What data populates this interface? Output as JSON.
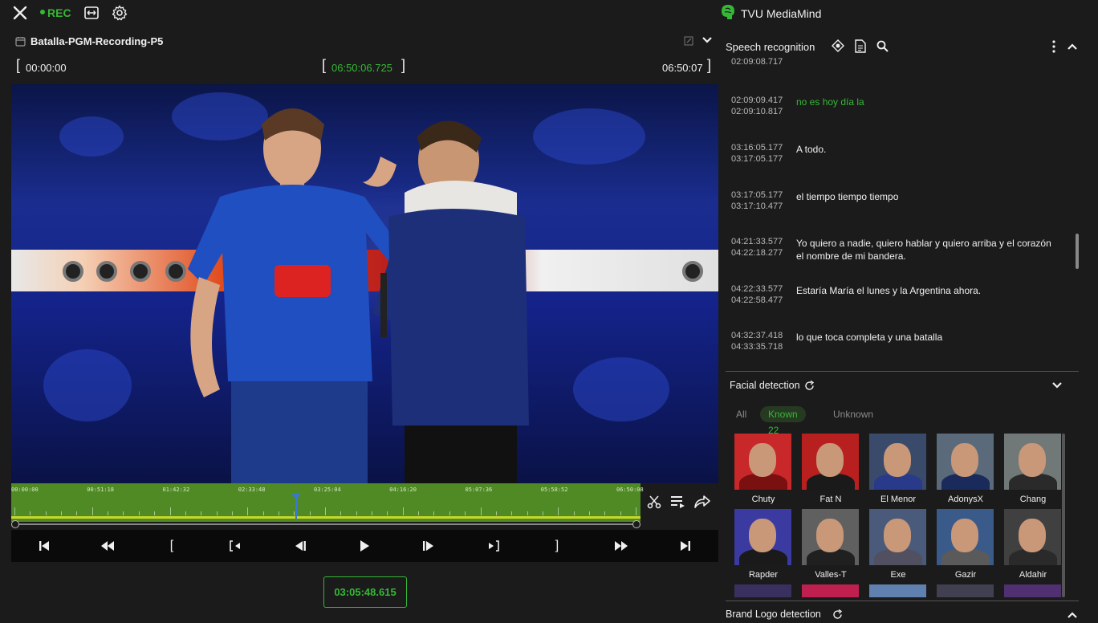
{
  "toolbar": {
    "close_icon": "close-icon",
    "rec_label": "REC",
    "fit_icon": "fit-width-icon",
    "settings_icon": "gear-icon"
  },
  "file": {
    "name": "Batalla-PGM-Recording-P5",
    "icon": "calendar-icon"
  },
  "times": {
    "start": "00:00:00",
    "in_point": "06:50:06.725",
    "end": "06:50:07",
    "current": "03:05:48.615"
  },
  "timeline": {
    "ticks": [
      "00:00:00",
      "00:51:18",
      "01:42:32",
      "02:33:48",
      "03:25:04",
      "04:16:20",
      "05:07:36",
      "05:58:52",
      "06:50:08"
    ],
    "playhead_fraction": 0.452
  },
  "controls": {
    "skip_start": "skip-to-start-icon",
    "rewind": "rewind-icon",
    "mark_in": "[",
    "go_in": "go-to-in-icon",
    "step_back": "step-back-icon",
    "play": "play-icon",
    "step_forward": "step-forward-icon",
    "go_out": "go-to-out-icon",
    "mark_out": "]",
    "fast_forward": "fast-forward-icon",
    "skip_end": "skip-to-end-icon"
  },
  "brand": {
    "name": "TVU MediaMind",
    "accent": "#35b836"
  },
  "speech": {
    "title": "Speech recognition",
    "items": [
      {
        "start": "",
        "end": "02:09:08.717",
        "text": ""
      },
      {
        "start": "02:09:09.417",
        "end": "02:09:10.817",
        "text": "no es hoy día la",
        "active": true
      },
      {
        "start": "03:16:05.177",
        "end": "03:17:05.177",
        "text": "A todo."
      },
      {
        "start": "03:17:05.177",
        "end": "03:17:10.477",
        "text": "el tiempo tiempo tiempo"
      },
      {
        "start": "04:21:33.577",
        "end": "04:22:18.277",
        "text": "Yo quiero a nadie, quiero hablar y quiero arriba y el corazón el nombre de mi bandera."
      },
      {
        "start": "04:22:33.577",
        "end": "04:22:58.477",
        "text": "Estaría María el lunes y la Argentina ahora."
      },
      {
        "start": "04:32:37.418",
        "end": "04:33:35.718",
        "text": "lo que toca completa y una batalla"
      }
    ]
  },
  "facial": {
    "title": "Facial detection",
    "tabs": [
      "All",
      "Known 22",
      "Unknown"
    ],
    "active_tab": 1,
    "faces": [
      {
        "name": "Chuty",
        "bg": "#c8282a",
        "shirt": "#7a1010"
      },
      {
        "name": "Fat N",
        "bg": "#b82020",
        "shirt": "#1a1a1a"
      },
      {
        "name": "El Menor",
        "bg": "#3a4a6a",
        "shirt": "#2a3a8a"
      },
      {
        "name": "AdonysX",
        "bg": "#5a6a7a",
        "shirt": "#1a2a5a"
      },
      {
        "name": "Chang",
        "bg": "#707878",
        "shirt": "#2a2a2a"
      },
      {
        "name": "Rapder",
        "bg": "#3a3aa0",
        "shirt": "#1a1a1a"
      },
      {
        "name": "Valles-T",
        "bg": "#606060",
        "shirt": "#202020"
      },
      {
        "name": "Exe",
        "bg": "#4a5a7a",
        "shirt": "#505060"
      },
      {
        "name": "Gazir",
        "bg": "#3a5a8a",
        "shirt": "#5a5a5a"
      },
      {
        "name": "Aldahir",
        "bg": "#404040",
        "shirt": "#2a2a2a"
      }
    ]
  },
  "brand_logo": {
    "title": "Brand Logo detection"
  }
}
